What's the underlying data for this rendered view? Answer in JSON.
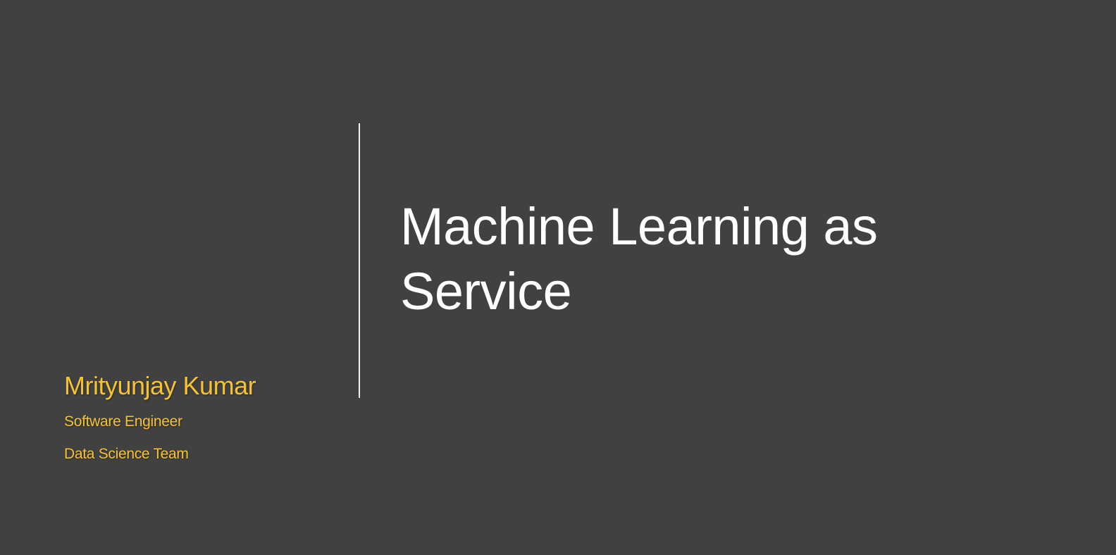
{
  "slide": {
    "title": "Machine Learning as Service",
    "author": {
      "name": "Mrityunjay Kumar",
      "role": "Software Engineer",
      "team": "Data Science Team"
    }
  },
  "colors": {
    "background": "#414141",
    "title": "#ffffff",
    "accent": "#f5c232",
    "divider": "#f2f2f2"
  }
}
